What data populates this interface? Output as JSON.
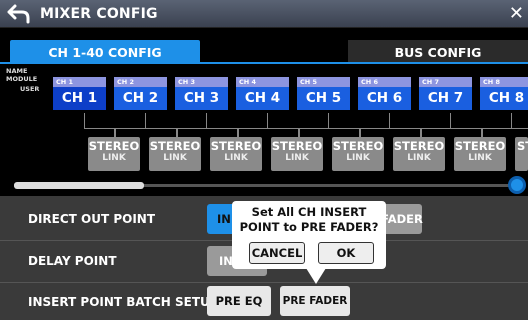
{
  "header": {
    "title": "MIXER CONFIG"
  },
  "tabs": [
    {
      "label": "CH 1-40 CONFIG",
      "active": true
    },
    {
      "label": "BUS CONFIG",
      "active": false
    }
  ],
  "row_labels": {
    "name": "NAME",
    "module": "MODULE",
    "user": "USER"
  },
  "channels": [
    {
      "module": "CH 1",
      "user": "CH 1"
    },
    {
      "module": "CH 2",
      "user": "CH 2"
    },
    {
      "module": "CH 3",
      "user": "CH 3"
    },
    {
      "module": "CH 4",
      "user": "CH 4"
    },
    {
      "module": "CH 5",
      "user": "CH 5"
    },
    {
      "module": "CH 6",
      "user": "CH 6"
    },
    {
      "module": "CH 7",
      "user": "CH 7"
    },
    {
      "module": "CH 8",
      "user": "CH 8"
    }
  ],
  "stereo_link": {
    "line1": "STEREO",
    "line2": "LINK",
    "partial_line1": "ST"
  },
  "settings": {
    "direct_out": {
      "label": "DIRECT OUT POINT",
      "opt1_partial": "IN",
      "opt2_partial": "FADER"
    },
    "delay": {
      "label": "DELAY POINT",
      "opt1_partial": "IN"
    },
    "insert_batch": {
      "label": "INSERT POINT BATCH SETUP",
      "pre_eq": "PRE EQ",
      "pre_fader": "PRE FADER"
    }
  },
  "popup": {
    "line1": "Set All CH INSERT",
    "line2": "POINT to PRE FADER?",
    "cancel": "CANCEL",
    "ok": "OK"
  },
  "colors": {
    "accent": "#1e90e8",
    "module_strip": "#8d95e0",
    "user_strip": "#1a5fe0",
    "panel": "#3a3a3a"
  }
}
